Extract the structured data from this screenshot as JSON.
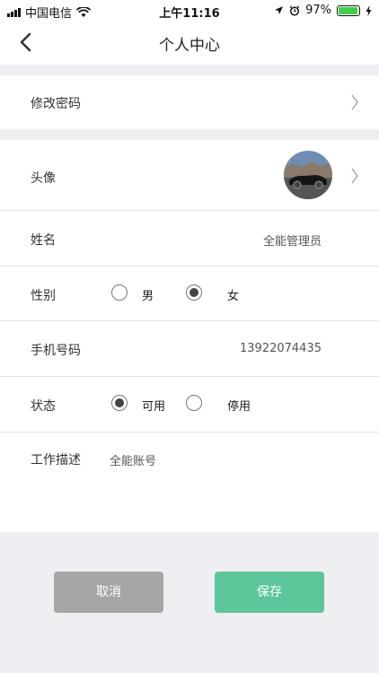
{
  "status_bar": {
    "carrier": "中国电信",
    "time": "上午11:16",
    "battery": "97%",
    "battery_level": 0.97,
    "colors": {
      "battery_fill": "#3fcf4a"
    }
  },
  "nav": {
    "title": "个人中心",
    "back_icon": "chevron-left-icon"
  },
  "settings": {
    "change_password": "修改密码"
  },
  "profile": {
    "avatar_label": "头像",
    "name_label": "姓名",
    "name_value": "全能管理员",
    "gender_label": "性别",
    "gender_options": [
      "男",
      "女"
    ],
    "gender_selected": "女",
    "phone_label": "手机号码",
    "phone_value": "13922074435",
    "status_label": "状态",
    "status_options": [
      "可用",
      "停用"
    ],
    "status_selected": "可用",
    "desc_label": "工作描述",
    "desc_value": "全能账号"
  },
  "actions": {
    "cancel": "取消",
    "save": "保存",
    "colors": {
      "cancel": "#a6a6a6",
      "save": "#5cc69a"
    }
  }
}
